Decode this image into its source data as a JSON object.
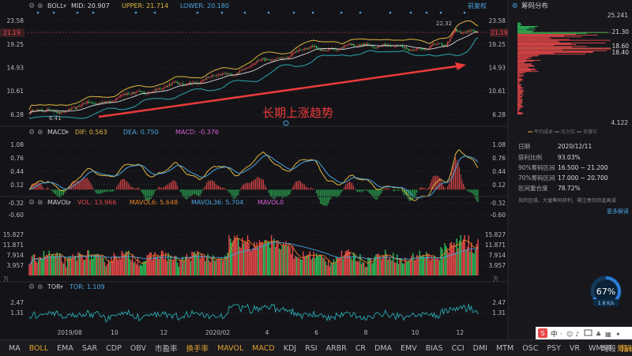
{
  "colors": {
    "bg": "#141418",
    "grid": "#272a33",
    "up": "#e8484a",
    "down": "#2ebd59",
    "yellow": "#e0b640",
    "orange": "#e67e22",
    "blue": "#4aa3df",
    "pink": "#d65dd6",
    "cyan": "#2aa7b0",
    "white": "#d8d8d8",
    "arrow": "#ec3b3b",
    "right_panel": "#17171c",
    "ring": "#2e7cd6"
  },
  "boll_panel": {
    "name": "BOLL",
    "mid": "MID: 20.907",
    "upper": "UPPER: 21.714",
    "lower": "LOWER: 20.180",
    "restore_label": "前复权",
    "current_price": "21.19",
    "annotation": "长期上涨趋势",
    "high_label": "22.32",
    "low_label": "6.41",
    "y_ticks": [
      "23.58",
      "19.25",
      "14.93",
      "10.61",
      "6.28"
    ],
    "y_values": [
      23.58,
      19.25,
      14.93,
      10.61,
      6.28
    ]
  },
  "macd_panel": {
    "name": "MACD",
    "dif": "DIF: 0.563",
    "dea": "DEA: 0.750",
    "macd": "MACD: -0.376",
    "y_ticks": [
      "1.08",
      "0.76",
      "0.44",
      "0.12",
      "-0.32",
      "-0.60"
    ],
    "y_values": [
      1.08,
      0.76,
      0.44,
      0.12,
      -0.32,
      -0.6
    ]
  },
  "mavol_panel": {
    "name": "MAVOL",
    "vol": "VOL: 13.966",
    "mavol6": "MAVOL6: 5.648",
    "mavol36": "MAVOL36: 5.704",
    "mavol0": "MAVOL0",
    "y_ticks": [
      "15.827",
      "11.871",
      "7.914",
      "3.957"
    ],
    "y_values": [
      15.827,
      11.871,
      7.914,
      3.957
    ],
    "unit": "万"
  },
  "tor_panel": {
    "name": "TOR",
    "tor": "TOR: 1.109",
    "y_ticks": [
      "2.47",
      "1.31"
    ],
    "y_values": [
      2.47,
      1.31
    ]
  },
  "x_axis_labels": [
    "2019/08",
    "10",
    "12",
    "2020/02",
    "4",
    "6",
    "8",
    "10",
    "12"
  ],
  "chip_distribution": {
    "title": "筹码分布",
    "top_value": "25.241",
    "price_labels": [
      "21.30",
      "18.60",
      "18.40"
    ],
    "bottom_value": "4.122",
    "legend": [
      "平均成本",
      "压力位",
      "支撑位"
    ],
    "rows": [
      {
        "label": "日期",
        "value": "2020/12/11"
      },
      {
        "label": "获利比例",
        "value": "93.03%"
      },
      {
        "label": "90%筹码区间",
        "value": "16.500 ~ 21.200"
      },
      {
        "label": "70%筹码区间",
        "value": "17.000 ~ 20.700"
      },
      {
        "label": "区间重合度",
        "value": "78.72%"
      }
    ],
    "note": "风险区域。大量筹码获利，需注意风险逢高减",
    "more_link": "更多解读"
  },
  "speed_widget": {
    "percent": "67%",
    "rate": "1.8 K/s",
    "level": 0.67
  },
  "tray": {
    "ime_char": "中",
    "ime_dot": "·"
  },
  "bottom_tabs": [
    "MA",
    "BOLL",
    "EMA",
    "SAR",
    "CDP",
    "OBV",
    "市盈率",
    "换手率",
    "MAVOL",
    "MACD",
    "KDJ",
    "RSI",
    "ARBR",
    "CR",
    "DMA",
    "EMV",
    "BIAS",
    "CCI",
    "DMI",
    "MTM",
    "OSC",
    "PSY",
    "VR",
    "WMSR",
    "指标管理"
  ],
  "bottom_tab_states": [
    "",
    "active",
    "",
    "",
    "",
    "",
    "",
    "y",
    "y",
    "y",
    "",
    "",
    "",
    "",
    "",
    "",
    "",
    "",
    "",
    "",
    "",
    "",
    "",
    "",
    "y"
  ],
  "bottom_right_tabs": [
    "时段",
    "筹码"
  ],
  "bottom_right_states": [
    "",
    "y"
  ]
}
